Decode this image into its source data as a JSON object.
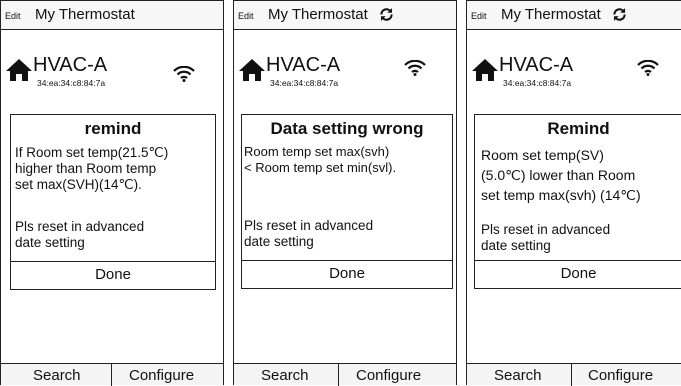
{
  "screens": [
    {
      "header": {
        "edit": "Edit",
        "title": "My Thermostat"
      },
      "device": {
        "name": "HVAC-A",
        "mac": "34:ea:34:c8:84:7a"
      },
      "dialog": {
        "title": "remind",
        "lines": [
          "If Room set temp(21.5℃)",
          "higher than Room temp",
          "set max(SVH)(14℃)."
        ],
        "note": [
          "Pls reset in advanced",
          "date setting"
        ],
        "button": "Done"
      },
      "tabs": [
        "Search",
        "Configure"
      ]
    },
    {
      "header": {
        "edit": "Edit",
        "title": "My Thermostat"
      },
      "device": {
        "name": "HVAC-A",
        "mac": "34:ea:34:c8:84:7a"
      },
      "dialog": {
        "title": "Data setting wrong",
        "lines": [
          "Room temp set max(svh)",
          "< Room temp set min(svl)."
        ],
        "note": [
          "Pls reset in advanced",
          "date setting"
        ],
        "button": "Done"
      },
      "tabs": [
        "Search",
        "Configure"
      ]
    },
    {
      "header": {
        "edit": "Edit",
        "title": "My Thermostat"
      },
      "device": {
        "name": "HVAC-A",
        "mac": "34:ea:34:c8:84:7a"
      },
      "dialog": {
        "title": "Remind",
        "lines": [
          "Room set temp(SV)",
          "(5.0℃) lower than Room",
          "set temp max(svh) (14℃)"
        ],
        "note": [
          "Pls reset in advanced",
          "date setting"
        ],
        "button": "Done"
      },
      "tabs": [
        "Search",
        "Configure"
      ]
    }
  ]
}
